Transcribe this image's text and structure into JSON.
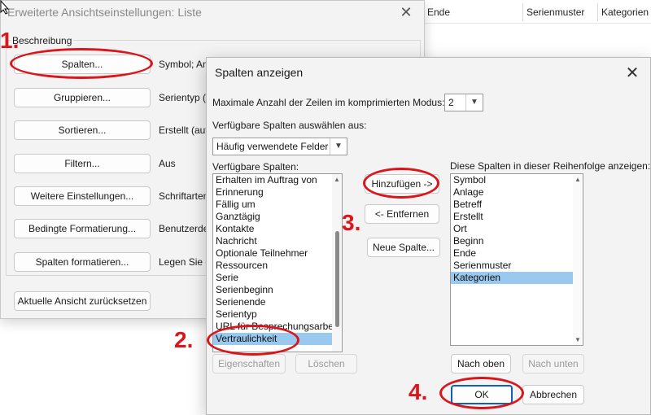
{
  "colors": {
    "annotation_red": "#d9161c",
    "selection_blue": "#99c9ef",
    "primary_border": "#0b62c4"
  },
  "background_list": {
    "columns": [
      "Ende",
      "Serienmuster",
      "Kategorien"
    ]
  },
  "dialog1": {
    "title": "Erweiterte Ansichtseinstellungen: Liste",
    "group_label": "Beschreibung",
    "rows": [
      {
        "button": "Spalten...",
        "description": "Symbol; An"
      },
      {
        "button": "Gruppieren...",
        "description": "Serientyp (a"
      },
      {
        "button": "Sortieren...",
        "description": "Erstellt (auf"
      },
      {
        "button": "Filtern...",
        "description": "Aus"
      },
      {
        "button": "Weitere Einstellungen...",
        "description": "Schriftarten"
      },
      {
        "button": "Bedingte Formatierung...",
        "description": "Benutzerde"
      },
      {
        "button": "Spalten formatieren...",
        "description": "Legen Sie d"
      }
    ],
    "reset_button": "Aktuelle Ansicht zurücksetzen"
  },
  "dialog2": {
    "title": "Spalten anzeigen",
    "max_rows_label": "Maximale Anzahl der Zeilen im komprimierten Modus:",
    "max_rows_value": "2",
    "select_from_label": "Verfügbare Spalten auswählen aus:",
    "select_from_value": "Häufig verwendete Felder",
    "available_label": "Verfügbare Spalten:",
    "available_items": [
      "Erhalten im Auftrag von",
      "Erinnerung",
      "Fällig um",
      "Ganztägig",
      "Kontakte",
      "Nachricht",
      "Optionale Teilnehmer",
      "Ressourcen",
      "Serie",
      "Serienbeginn",
      "Serienende",
      "Serientyp",
      "URL für Besprechungsarbei",
      "Vertraulichkeit"
    ],
    "available_selected": "Vertraulichkeit",
    "add_button": "Hinzufügen ->",
    "remove_button": "<- Entfernen",
    "new_column_button": "Neue Spalte...",
    "shown_label": "Diese Spalten in dieser Reihenfolge anzeigen:",
    "shown_items": [
      "Symbol",
      "Anlage",
      "Betreff",
      "Erstellt",
      "Ort",
      "Beginn",
      "Ende",
      "Serienmuster",
      "Kategorien"
    ],
    "shown_selected": "Kategorien",
    "properties_button": "Eigenschaften",
    "delete_button": "Löschen",
    "move_up_button": "Nach oben",
    "move_down_button": "Nach unten",
    "ok_button": "OK",
    "cancel_button": "Abbrechen"
  },
  "annotations": {
    "step1": "1.",
    "step2": "2.",
    "step3": "3.",
    "step4": "4."
  }
}
